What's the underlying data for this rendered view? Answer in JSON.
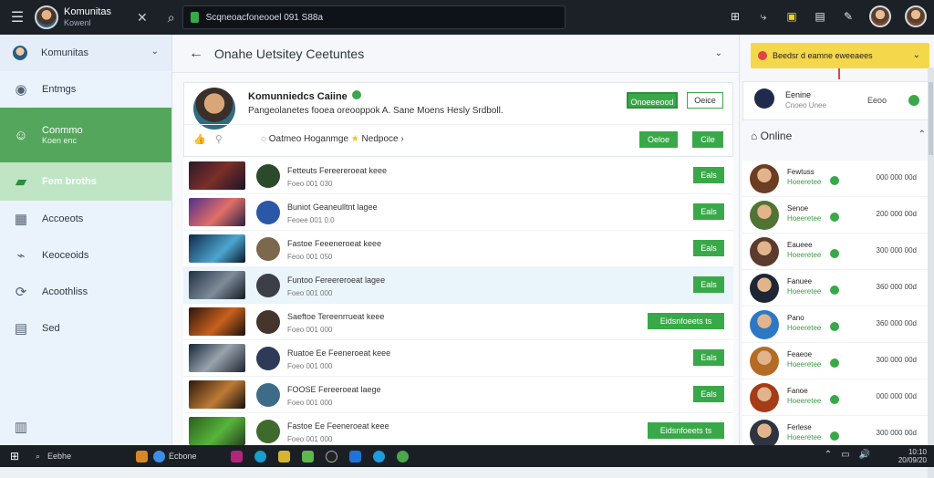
{
  "topbar": {
    "app_name": "Komunitas",
    "app_sub": "Kowenl",
    "search_text": "Scqneoacfoneooel 091 S88a",
    "icons": [
      "menu-icon",
      "close-icon",
      "search-icon",
      "grid-icon",
      "share-icon",
      "badge-icon",
      "doc-icon",
      "edit-icon"
    ]
  },
  "sidebar": {
    "items": [
      {
        "label": "Komunitas",
        "icon": "globe-avatar",
        "active": false,
        "kind": "community"
      },
      {
        "label": "Entmgs",
        "icon": "shield-icon",
        "active": false
      },
      {
        "label": "Conmmo",
        "sublabel": "Koen enc",
        "icon": "user-icon",
        "active": true
      },
      {
        "label": "Fem broths",
        "icon": "group-icon",
        "active": "light"
      },
      {
        "label": "Accoeots",
        "icon": "building-icon",
        "active": false
      },
      {
        "label": "Keoceoids",
        "icon": "chart-icon",
        "active": false
      },
      {
        "label": "Acoothliss",
        "icon": "link-icon",
        "active": false
      },
      {
        "label": "Sed",
        "icon": "calendar-icon",
        "active": false
      }
    ],
    "bottom_icon": "list-icon"
  },
  "main": {
    "title": "Onahe  Uetsitey Ceetuntes",
    "card": {
      "name": "Komunniedcs Caiine",
      "description": "Pangeolanetes fooea oreooppok A. Sane Moens Hesly Srdboll.",
      "join_button": "Onoeeeood",
      "secondary_button": "Oeice",
      "filter": "Oatmeo Hoganmge",
      "filter_tag": "Nedpoce",
      "action_buttons": [
        "Oeloe",
        "Cile"
      ]
    },
    "rows": [
      {
        "title": "Fetteuts  Fereereroeat keee",
        "meta": "Foeo    001 030",
        "button": "Eals",
        "thumb": "linear-gradient(135deg,#2b1a2c,#7b2f28 50%,#1a1328)",
        "avatar": "#2b4a2a",
        "highlight": false
      },
      {
        "title": "Buniot  Geaneulltnt lagee",
        "meta": "Feoee    001 0.0",
        "button": "Eals",
        "thumb": "linear-gradient(135deg,#512f8a,#e16f68 55%,#2b2244)",
        "avatar": "#2a57a8",
        "highlight": false
      },
      {
        "title": "Fastoe  Feeeneroeat keee",
        "meta": "Feoo    001 050",
        "button": "Eals",
        "thumb": "linear-gradient(135deg,#0f2a4a,#4da6cf 60%,#0b1628)",
        "avatar": "#7b684d",
        "highlight": false
      },
      {
        "title": "Funtoo  Fereereroeat lagee",
        "meta": "Foeo    001 000",
        "button": "Eals",
        "thumb": "linear-gradient(135deg,#203243,#7f8c99 55%,#121a22)",
        "avatar": "#3c3f46",
        "highlight": true
      },
      {
        "title": "Saeftoe  Tereenrrueat keee",
        "meta": "Foeo    001 000",
        "button": "Eidsnfoeets ts",
        "thumb": "linear-gradient(135deg,#2b160c,#c8611c 55%,#17110b)",
        "avatar": "#45352d",
        "highlight": false
      },
      {
        "title": "Ruatoe  Ee  Feeneroeat keee",
        "meta": "Foeo    001 000",
        "button": "Eals",
        "thumb": "linear-gradient(135deg,#15263b,#9aa3ac 50%,#1d2531)",
        "avatar": "#2e3b58",
        "highlight": false
      },
      {
        "title": "FOOSE  Fereeroeat laege",
        "meta": "Foeo    001 000",
        "button": "Eals",
        "thumb": "linear-gradient(135deg,#2b1a0c,#bf7b35 55%,#15100d)",
        "avatar": "#3e6b88",
        "highlight": false
      },
      {
        "title": "Fastoe  Ee  Feeneroeat keee",
        "meta": "Foeo    001 000",
        "button": "Eidsnfoeets ts",
        "thumb": "linear-gradient(135deg,#2b5f1b,#56b43c 55%,#24411f)",
        "avatar": "#3f6a2d",
        "highlight": false
      }
    ]
  },
  "right": {
    "promo": "Beedsr d eamne eweeaees",
    "profile": {
      "name": "Eenine",
      "sub": "Cnoeo Unee",
      "mid": "Eeoo"
    },
    "online_title": "Online",
    "online_users": [
      {
        "name": "Fewtuss",
        "status": "Hoeeretee",
        "score": "000 000 00d"
      },
      {
        "name": "Senoe",
        "status": "Hoeeretee",
        "score": "200 000 00d"
      },
      {
        "name": "Eaueee",
        "status": "Hoeeretee",
        "score": "300 000 00d"
      },
      {
        "name": "Fanuee",
        "status": "Hoeeretee",
        "score": "360 000 00d"
      },
      {
        "name": "Pano",
        "status": "Hoeeretee",
        "score": "360 000 00d"
      },
      {
        "name": "Feaeoe",
        "status": "Hoeeretee",
        "score": "300 000 00d"
      },
      {
        "name": "Fanoe",
        "status": "Hoeeretee",
        "score": "000 000 00d"
      },
      {
        "name": "Ferlese",
        "status": "Hoeeretee",
        "score": "300 000 00d"
      }
    ]
  },
  "taskbar": {
    "search": "Eebhe",
    "app_label": "Ecbone",
    "time": "10:10",
    "date": "20/09/20"
  }
}
